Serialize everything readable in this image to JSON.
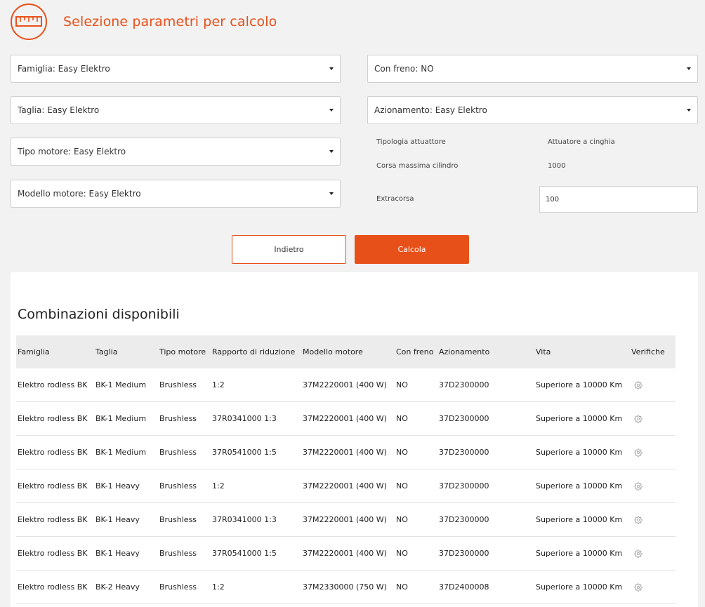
{
  "header": {
    "title": "Selezione parametri per calcolo",
    "logo_icon": "ruler-icon"
  },
  "form": {
    "famiglia": "Famiglia: Easy Elektro",
    "taglia": "Taglia: Easy Elektro",
    "tipo_motore": "Tipo motore: Easy Elektro",
    "modello_motore": "Modello motore: Easy Elektro",
    "con_freno": "Con freno: NO",
    "azionamento": "Azionamento: Easy Elektro",
    "tipologia_label": "Tipologia attuattore",
    "tipologia_value": "Attuatore a cinghia",
    "corsa_label": "Corsa massima cilindro",
    "corsa_value": "1000",
    "extracorsa_label": "Extracorsa",
    "extracorsa_value": "100"
  },
  "buttons": {
    "back": "Indietro",
    "calc": "Calcola"
  },
  "results": {
    "title": "Combinazioni disponibili",
    "columns": [
      "Famiglia",
      "Taglia",
      "Tipo motore",
      "Rapporto di riduzione",
      "Modello motore",
      "Con freno",
      "Azionamento",
      "Vita",
      "Verifiche"
    ],
    "rows": [
      [
        "Elektro rodless BK",
        "BK-1 Medium",
        "Brushless",
        "1:2",
        "37M2220001 (400 W)",
        "NO",
        "37D2300000",
        "Superiore a 10000 Km"
      ],
      [
        "Elektro rodless BK",
        "BK-1 Medium",
        "Brushless",
        "37R0341000 1:3",
        "37M2220001 (400 W)",
        "NO",
        "37D2300000",
        "Superiore a 10000 Km"
      ],
      [
        "Elektro rodless BK",
        "BK-1 Medium",
        "Brushless",
        "37R0541000 1:5",
        "37M2220001 (400 W)",
        "NO",
        "37D2300000",
        "Superiore a 10000 Km"
      ],
      [
        "Elektro rodless BK",
        "BK-1 Heavy",
        "Brushless",
        "1:2",
        "37M2220001 (400 W)",
        "NO",
        "37D2300000",
        "Superiore a 10000 Km"
      ],
      [
        "Elektro rodless BK",
        "BK-1 Heavy",
        "Brushless",
        "37R0341000 1:3",
        "37M2220001 (400 W)",
        "NO",
        "37D2300000",
        "Superiore a 10000 Km"
      ],
      [
        "Elektro rodless BK",
        "BK-1 Heavy",
        "Brushless",
        "37R0541000 1:5",
        "37M2220001 (400 W)",
        "NO",
        "37D2300000",
        "Superiore a 10000 Km"
      ],
      [
        "Elektro rodless BK",
        "BK-2 Heavy",
        "Brushless",
        "1:2",
        "37M2330000 (750 W)",
        "NO",
        "37D2400008",
        "Superiore a 10000 Km"
      ]
    ],
    "verify_icon": "gear-icon"
  },
  "colors": {
    "accent": "#e8501a",
    "background": "#f2f2f2"
  }
}
